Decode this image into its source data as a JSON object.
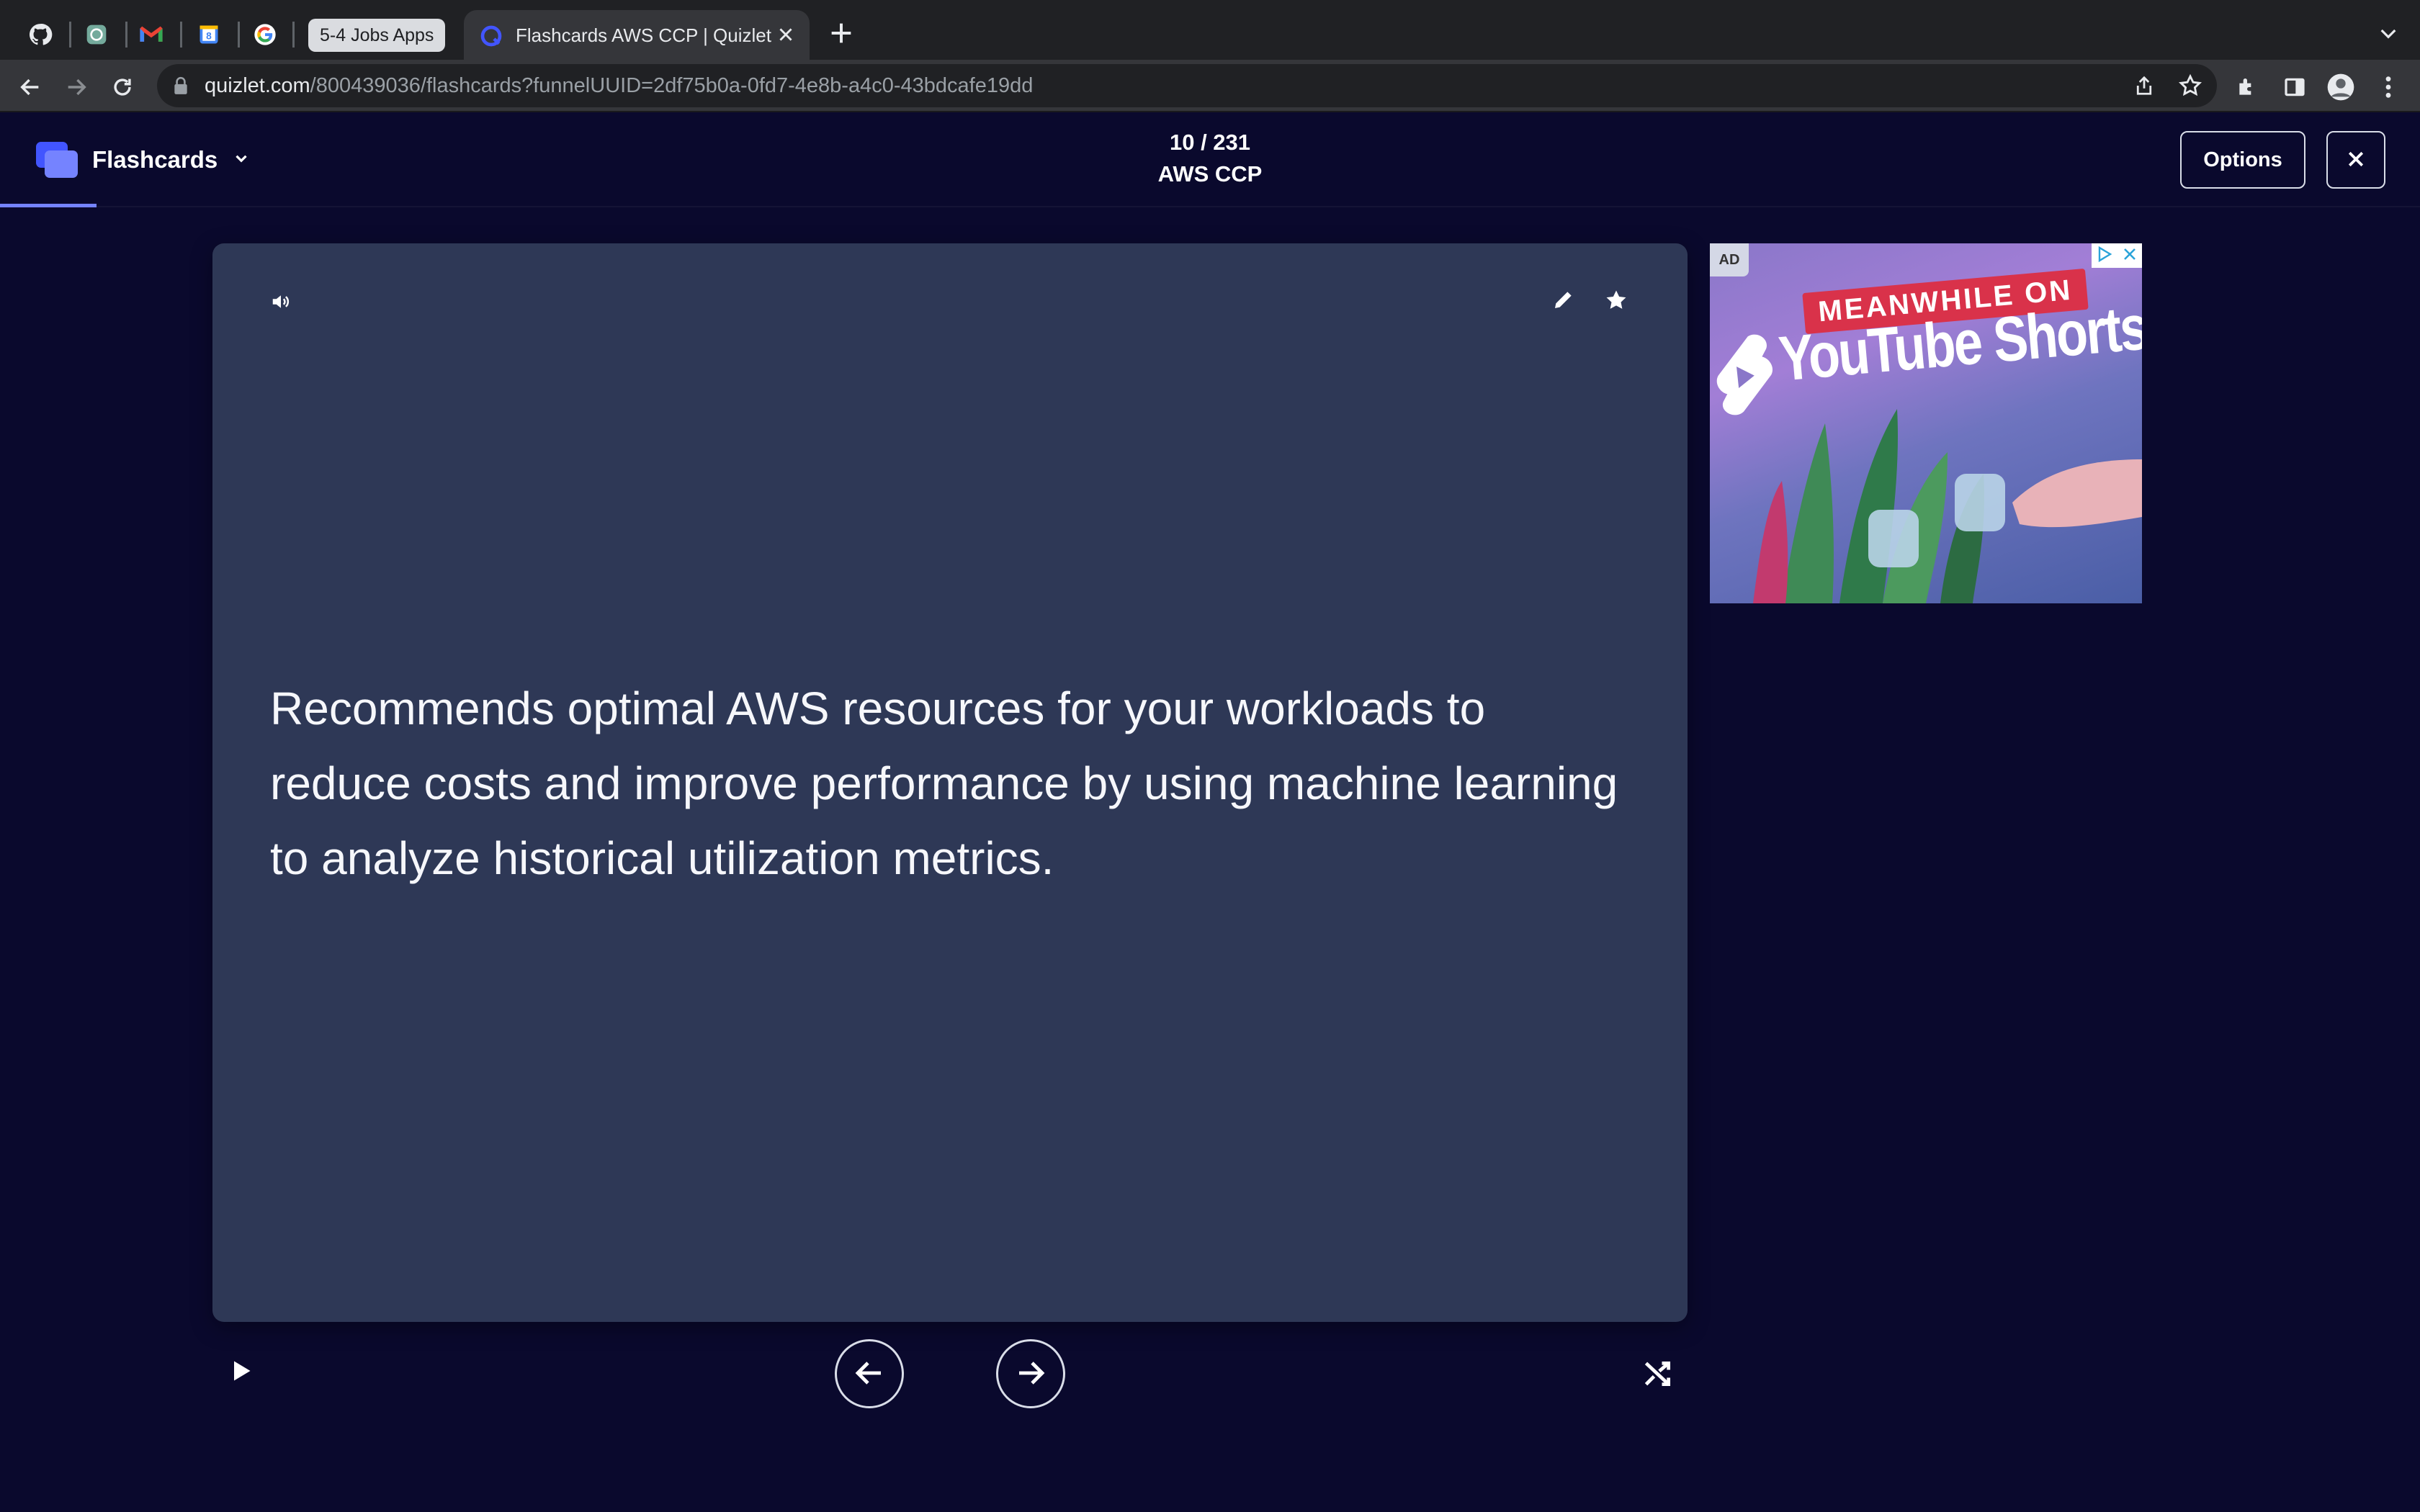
{
  "browser": {
    "pinned_tabs": [
      {
        "name": "github-tab",
        "icon": "github-icon"
      },
      {
        "name": "chatgpt-tab",
        "icon": "openai-icon"
      },
      {
        "name": "gmail-tab",
        "icon": "gmail-icon"
      },
      {
        "name": "calendar-tab",
        "icon": "calendar-icon"
      },
      {
        "name": "google-tab",
        "icon": "google-icon"
      }
    ],
    "tab_group_label": "5-4 Jobs Apps",
    "active_tab_title": "Flashcards AWS CCP | Quizlet",
    "url_host": "quizlet.com",
    "url_path": "/800439036/flashcards?funnelUUID=2df75b0a-0fd7-4e8b-a4c0-43bdcafe19dd"
  },
  "header": {
    "mode_label": "Flashcards",
    "progress": "10 / 231",
    "set_title": "AWS CCP",
    "options_label": "Options"
  },
  "card": {
    "text": "Recommends optimal AWS resources for your workloads to reduce costs and improve performance by using machine learning to analyze historical utilization metrics."
  },
  "ad": {
    "label": "AD",
    "ribbon": "MEANWHILE ON",
    "headline": "YouTube Shorts"
  },
  "colors": {
    "page_bg": "#0a092d",
    "card_bg": "#2e3856",
    "accent": "#4255ff"
  }
}
